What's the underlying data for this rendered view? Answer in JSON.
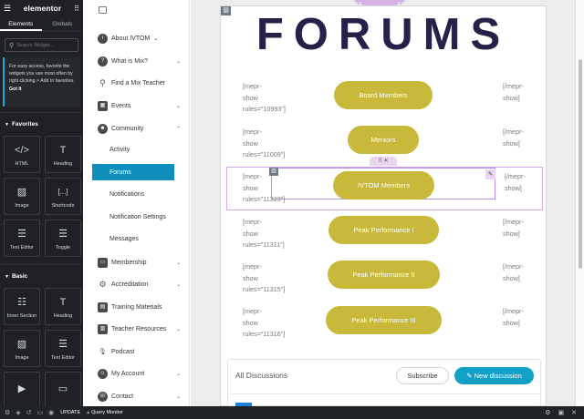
{
  "editor": {
    "brand": "elementor",
    "tabs": [
      "Elements",
      "Globals"
    ],
    "search_placeholder": "Search Widget...",
    "tip_text": "For easy access, favorite the widgets you use most often by right clicking > Add to favorites.",
    "tip_link": "Got It",
    "favorites_title": "Favorites",
    "basic_title": "Basic",
    "favorites": [
      {
        "label": "HTML",
        "icon": "html-icon",
        "glyph": "</>"
      },
      {
        "label": "Heading",
        "icon": "heading-icon",
        "glyph": "T"
      },
      {
        "label": "Image",
        "icon": "image-icon",
        "glyph": "▨"
      },
      {
        "label": "Shortcode",
        "icon": "shortcode-icon",
        "glyph": "[...]"
      },
      {
        "label": "Text Editor",
        "icon": "text-editor-icon",
        "glyph": "☰"
      },
      {
        "label": "Toggle",
        "icon": "toggle-icon",
        "glyph": "☰"
      }
    ],
    "basic": [
      {
        "label": "Inner Section",
        "icon": "inner-section-icon",
        "glyph": "☷"
      },
      {
        "label": "Heading",
        "icon": "heading-icon",
        "glyph": "T"
      },
      {
        "label": "Image",
        "icon": "image-icon",
        "glyph": "▨"
      },
      {
        "label": "Text Editor",
        "icon": "text-editor-icon",
        "glyph": "☰"
      },
      {
        "label": "",
        "icon": "video-icon",
        "glyph": "▶"
      },
      {
        "label": "",
        "icon": "button-icon",
        "glyph": "▭"
      }
    ],
    "footer_update": "UPDATE"
  },
  "admin_bar": {
    "query_monitor": "Query Monitor"
  },
  "site_nav": {
    "items": [
      {
        "label": "About IVTOM",
        "icon": "info-icon",
        "glyph": "i",
        "chevron": true
      },
      {
        "label": "What is Mix?",
        "icon": "question-icon",
        "glyph": "?",
        "chevron": true
      },
      {
        "label": "Find a Mix Teacher",
        "icon": "search-icon",
        "glyph": "⚲",
        "chevron": false
      },
      {
        "label": "Events",
        "icon": "calendar-icon",
        "glyph": "▦",
        "chevron": true
      },
      {
        "label": "Community",
        "icon": "community-icon",
        "glyph": "☻",
        "chevron": true,
        "expanded": true
      }
    ],
    "community_sub": [
      "Activity",
      "Forums",
      "Notifications",
      "Notification Settings",
      "Messages"
    ],
    "lower_items": [
      {
        "label": "Membership",
        "icon": "membership-icon",
        "glyph": "▭",
        "chevron": true
      },
      {
        "label": "Accreditation",
        "icon": "accreditation-icon",
        "glyph": "⚙",
        "chevron": true
      },
      {
        "label": "Training Materials",
        "icon": "training-icon",
        "glyph": "▤",
        "chevron": false
      },
      {
        "label": "Teacher Resources",
        "icon": "resources-icon",
        "glyph": "▥",
        "chevron": true
      },
      {
        "label": "Podcast",
        "icon": "microphone-icon",
        "glyph": "🎙",
        "chevron": false
      },
      {
        "label": "My Account",
        "icon": "account-icon",
        "glyph": "☺",
        "chevron": true
      },
      {
        "label": "Contact",
        "icon": "contact-icon",
        "glyph": "☏",
        "chevron": true
      }
    ]
  },
  "page": {
    "title": "FORUMS",
    "rows": [
      {
        "open": [
          "[mepr-",
          "show",
          "rules=\"10993\"]"
        ],
        "button": "Board Members",
        "close": [
          "[/mepr-",
          "show]"
        ]
      },
      {
        "open": [
          "[mepr-",
          "show",
          "rules=\"11009\"]"
        ],
        "button": "Mentors",
        "close": [
          "[/mepr-",
          "show]"
        ]
      },
      {
        "open": [
          "[mepr-",
          "show",
          "rules=\"11323\"]"
        ],
        "button": "IVTOM Members",
        "close": [
          "[/mepr-",
          "show]"
        ]
      },
      {
        "open": [
          "[mepr-",
          "show",
          "rules=\"11311\"]"
        ],
        "button": "Peak Performance I",
        "close": [
          "[/mepr-",
          "show]"
        ]
      },
      {
        "open": [
          "[mepr-",
          "show",
          "rules=\"11315\"]"
        ],
        "button": "Peak Performance II",
        "close": [
          "[/mepr-",
          "show]"
        ]
      },
      {
        "open": [
          "[mepr-",
          "show",
          "rules=\"11316\"]"
        ],
        "button": "Peak Performance III",
        "close": [
          "[/mepr-",
          "show]"
        ]
      }
    ],
    "discussions": {
      "title": "All Discussions",
      "subscribe": "Subscribe",
      "new_discussion": "New discussion",
      "new_discussion_icon": "✎"
    },
    "colors": {
      "title": "#27214a",
      "pill": "#c9b93a",
      "accent": "#12a0c7",
      "selection": "#d6a6e6"
    }
  }
}
